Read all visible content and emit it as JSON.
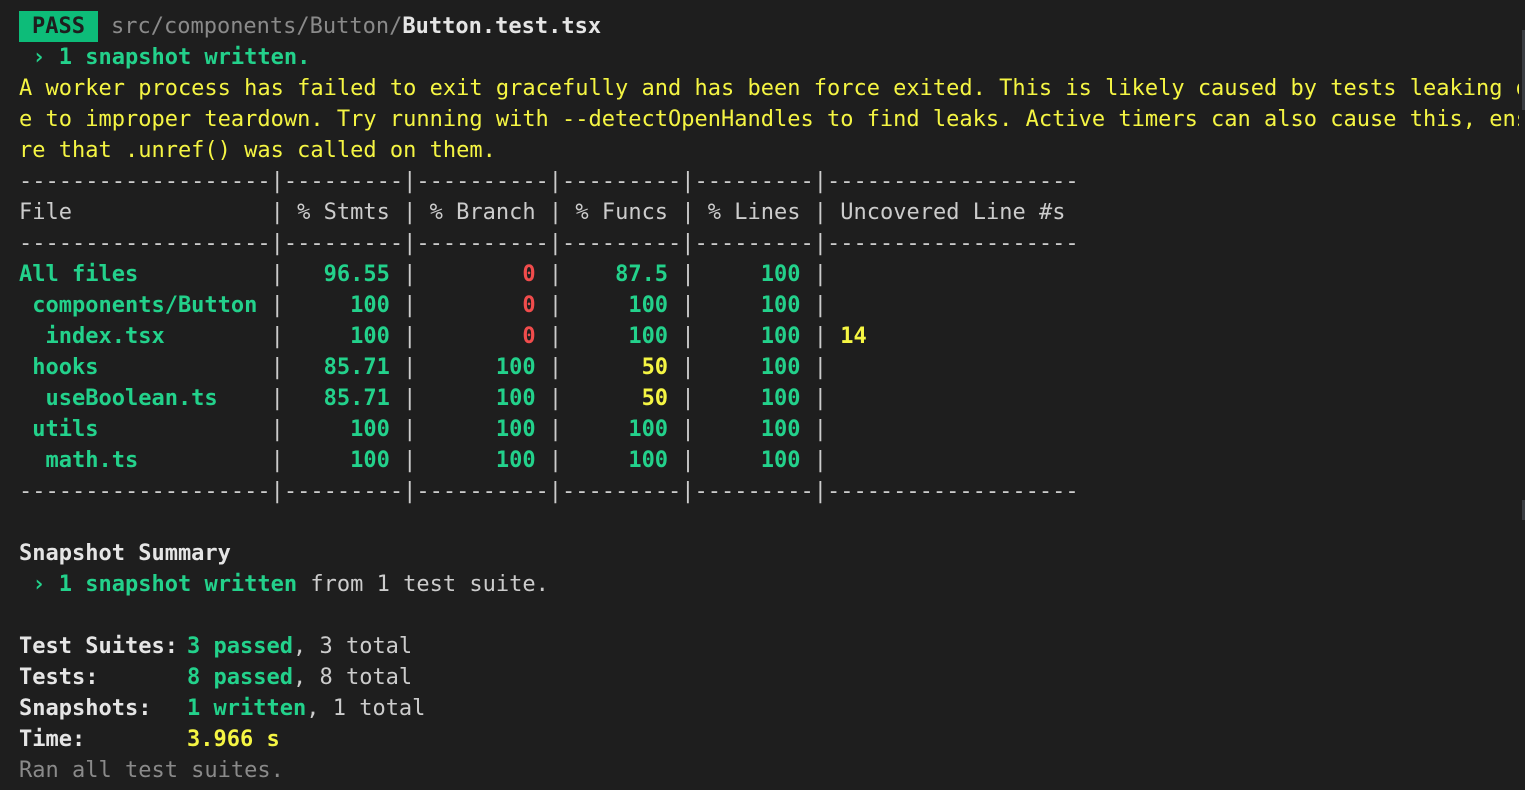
{
  "header": {
    "badge": "PASS",
    "path_dir": "src/components/Button/",
    "path_file": "Button.test.tsx"
  },
  "snapshot_note": " › 1 snapshot written.",
  "warning_lines": [
    "A worker process has failed to exit gracefully and has been force exited. This is likely caused by tests leaking du",
    "e to improper teardown. Try running with --detectOpenHandles to find leaks. Active timers can also cause this, ensu",
    "re that .unref() was called on them."
  ],
  "coverage": {
    "separator": "-------------------|---------|----------|---------|---------|-------------------",
    "headers": [
      "File",
      "% Stmts",
      "% Branch",
      "% Funcs",
      "% Lines",
      "Uncovered Line #s"
    ],
    "rows": [
      {
        "file": "All files",
        "indent": 0,
        "stmts": "96.55",
        "branch": "0",
        "funcs": "87.5",
        "lines": "100",
        "uncovered": "",
        "colors": {
          "stmts": "g",
          "branch": "r",
          "funcs": "g",
          "lines": "g"
        }
      },
      {
        "file": "components/Button",
        "indent": 1,
        "stmts": "100",
        "branch": "0",
        "funcs": "100",
        "lines": "100",
        "uncovered": "",
        "colors": {
          "stmts": "g",
          "branch": "r",
          "funcs": "g",
          "lines": "g"
        }
      },
      {
        "file": "index.tsx",
        "indent": 2,
        "stmts": "100",
        "branch": "0",
        "funcs": "100",
        "lines": "100",
        "uncovered": "14",
        "colors": {
          "stmts": "g",
          "branch": "r",
          "funcs": "g",
          "lines": "g"
        }
      },
      {
        "file": "hooks",
        "indent": 1,
        "stmts": "85.71",
        "branch": "100",
        "funcs": "50",
        "lines": "100",
        "uncovered": "",
        "colors": {
          "stmts": "g",
          "branch": "g",
          "funcs": "y",
          "lines": "g"
        }
      },
      {
        "file": "useBoolean.ts",
        "indent": 2,
        "stmts": "85.71",
        "branch": "100",
        "funcs": "50",
        "lines": "100",
        "uncovered": "",
        "colors": {
          "stmts": "g",
          "branch": "g",
          "funcs": "y",
          "lines": "g"
        }
      },
      {
        "file": "utils",
        "indent": 1,
        "stmts": "100",
        "branch": "100",
        "funcs": "100",
        "lines": "100",
        "uncovered": "",
        "colors": {
          "stmts": "g",
          "branch": "g",
          "funcs": "g",
          "lines": "g"
        }
      },
      {
        "file": "math.ts",
        "indent": 2,
        "stmts": "100",
        "branch": "100",
        "funcs": "100",
        "lines": "100",
        "uncovered": "",
        "colors": {
          "stmts": "g",
          "branch": "g",
          "funcs": "g",
          "lines": "g"
        }
      }
    ]
  },
  "snapshot_summary": {
    "title": "Snapshot Summary",
    "prefix": " › ",
    "highlight": "1 snapshot written",
    "rest": " from 1 test suite."
  },
  "summary": {
    "suites_label": "Test Suites:",
    "suites_passed": "3 passed",
    "suites_total": ", 3 total",
    "tests_label": "Tests:",
    "tests_passed": "8 passed",
    "tests_total": ", 8 total",
    "snapshots_label": "Snapshots:",
    "snapshots_written": "1 written",
    "snapshots_total": ", 1 total",
    "time_label": "Time:",
    "time_value": "3.966 s",
    "footer": "Ran all test suites."
  },
  "colors": {
    "background": "#1e1e1e",
    "green": "#23d18b",
    "badge_green": "#0dbc79",
    "yellow": "#f5f543",
    "red": "#f14c4c",
    "text": "#cccccc",
    "dim": "#8a8a8a"
  }
}
